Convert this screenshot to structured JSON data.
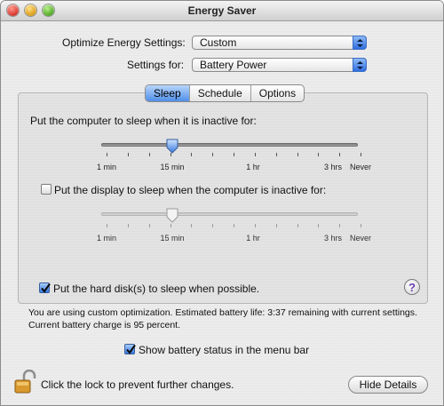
{
  "window": {
    "title": "Energy Saver"
  },
  "optimize": {
    "label": "Optimize Energy Settings:",
    "value": "Custom"
  },
  "settings_for": {
    "label": "Settings for:",
    "value": "Battery Power"
  },
  "tabs": [
    {
      "label": "Sleep",
      "active": true
    },
    {
      "label": "Schedule",
      "active": false
    },
    {
      "label": "Options",
      "active": false
    }
  ],
  "sleep": {
    "computer_label": "Put the computer to sleep when it is inactive for:",
    "computer_value": "15 min",
    "display_checkbox_label": "Put the display to sleep when the computer is inactive for:",
    "display_checked": false,
    "display_value": "15 min",
    "tick_labels": [
      "1 min",
      "15 min",
      "1 hr",
      "3 hrs",
      "Never"
    ],
    "harddisk_checkbox_label": "Put the hard disk(s) to sleep when possible.",
    "harddisk_checked": true
  },
  "help_glyph": "?",
  "info_line1": "You are using custom optimization. Estimated battery life: 3:37 remaining with current settings.",
  "info_line2": "Current battery charge is 95 percent.",
  "menu_bar": {
    "label": "Show battery status in the menu bar",
    "checked": true
  },
  "lock": {
    "icon": "lock-open-icon",
    "label": "Click the lock to prevent further changes."
  },
  "hide_details_button": "Hide Details",
  "colors": {
    "accent": "#3576de",
    "help_purple": "#6b3fb0"
  }
}
